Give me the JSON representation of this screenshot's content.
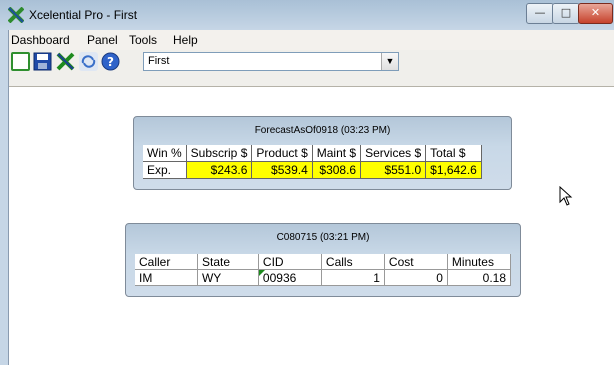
{
  "window": {
    "title": "Xcelential Pro - First"
  },
  "menu": [
    "Dashboard",
    "Panel",
    "Tools",
    "Help"
  ],
  "toolbar": {
    "icons": [
      "new-icon",
      "save-icon",
      "delete-icon",
      "refresh-icon",
      "help-icon"
    ],
    "select_value": "First"
  },
  "forecast_panel": {
    "title": "ForecastAsOf0918  (03:23 PM)",
    "headers": [
      "Win %",
      "Subscrip $",
      "Product $",
      "Maint $",
      "Services $",
      "Total $"
    ],
    "row": [
      "Exp.",
      "$243.6",
      "$539.4",
      "$308.6",
      "$551.0",
      "$1,642.6"
    ],
    "highlight_color": "#ffff00"
  },
  "calls_panel": {
    "title": "C080715  (03:21 PM)",
    "headers": [
      "Caller",
      "State",
      "CID",
      "Calls",
      "Cost",
      "Minutes"
    ],
    "row": [
      "IM",
      "WY",
      "00936",
      "1",
      "0",
      "0.18"
    ]
  }
}
